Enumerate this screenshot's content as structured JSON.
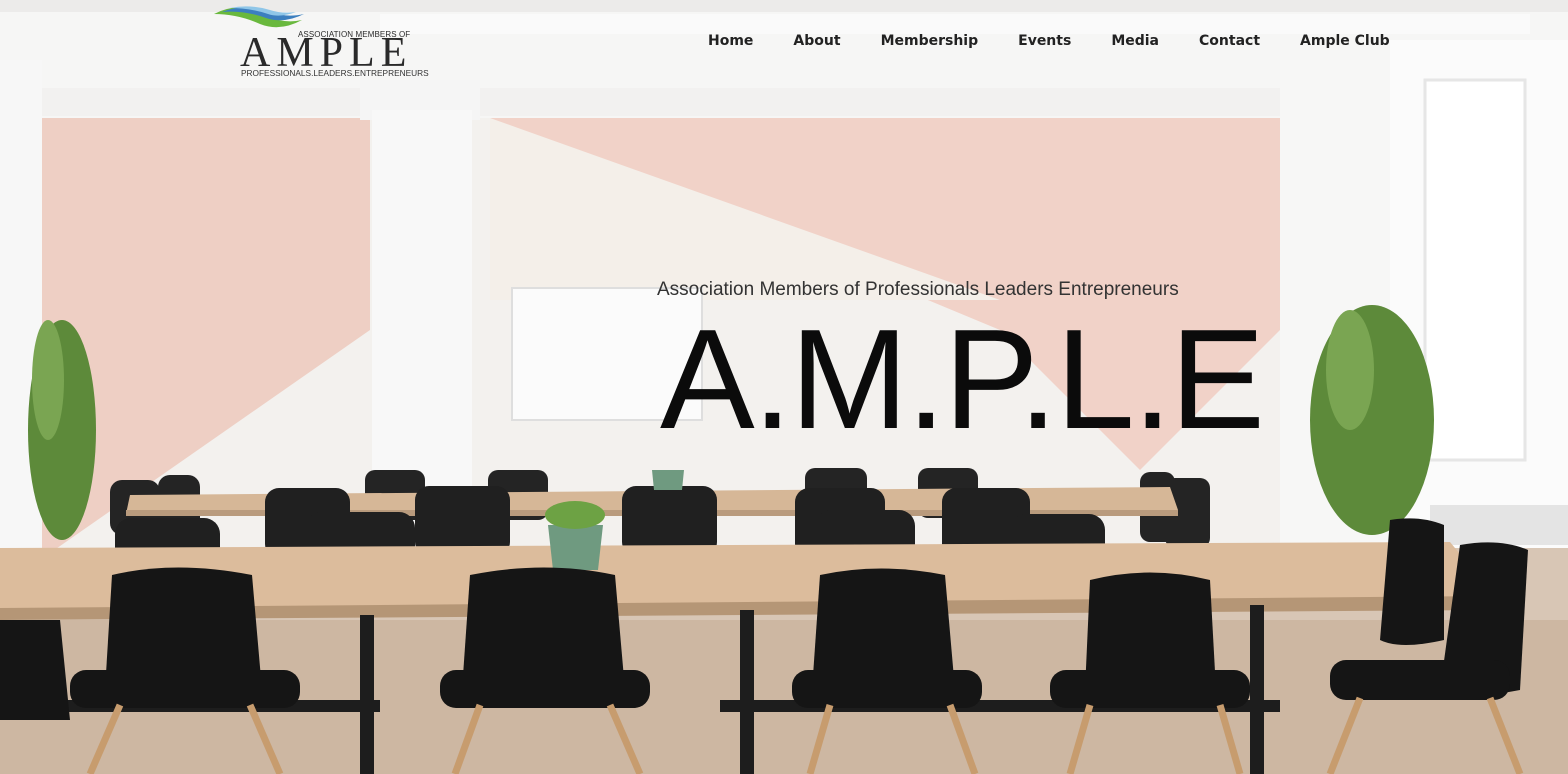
{
  "logo": {
    "top_line": "ASSOCIATION MEMBERS OF",
    "wordmark": "AMPLE",
    "sub_line": "PROFESSIONALS.LEADERS.ENTREPRENEURS"
  },
  "nav": {
    "items": [
      "Home",
      "About",
      "Membership",
      "Events",
      "Media",
      "Contact",
      "Ample Club"
    ]
  },
  "hero": {
    "subtitle": "Association Members of Professionals Leaders Entrepreneurs",
    "title": "A.M.P.L.E"
  },
  "colors": {
    "wall_pink": "#eecfc4",
    "wall_white": "#f3f1ee",
    "table_wood": "#d9b99a",
    "chair_black": "#1e1e1e",
    "nav_text": "#222222",
    "title_text": "#0b0b0b"
  }
}
